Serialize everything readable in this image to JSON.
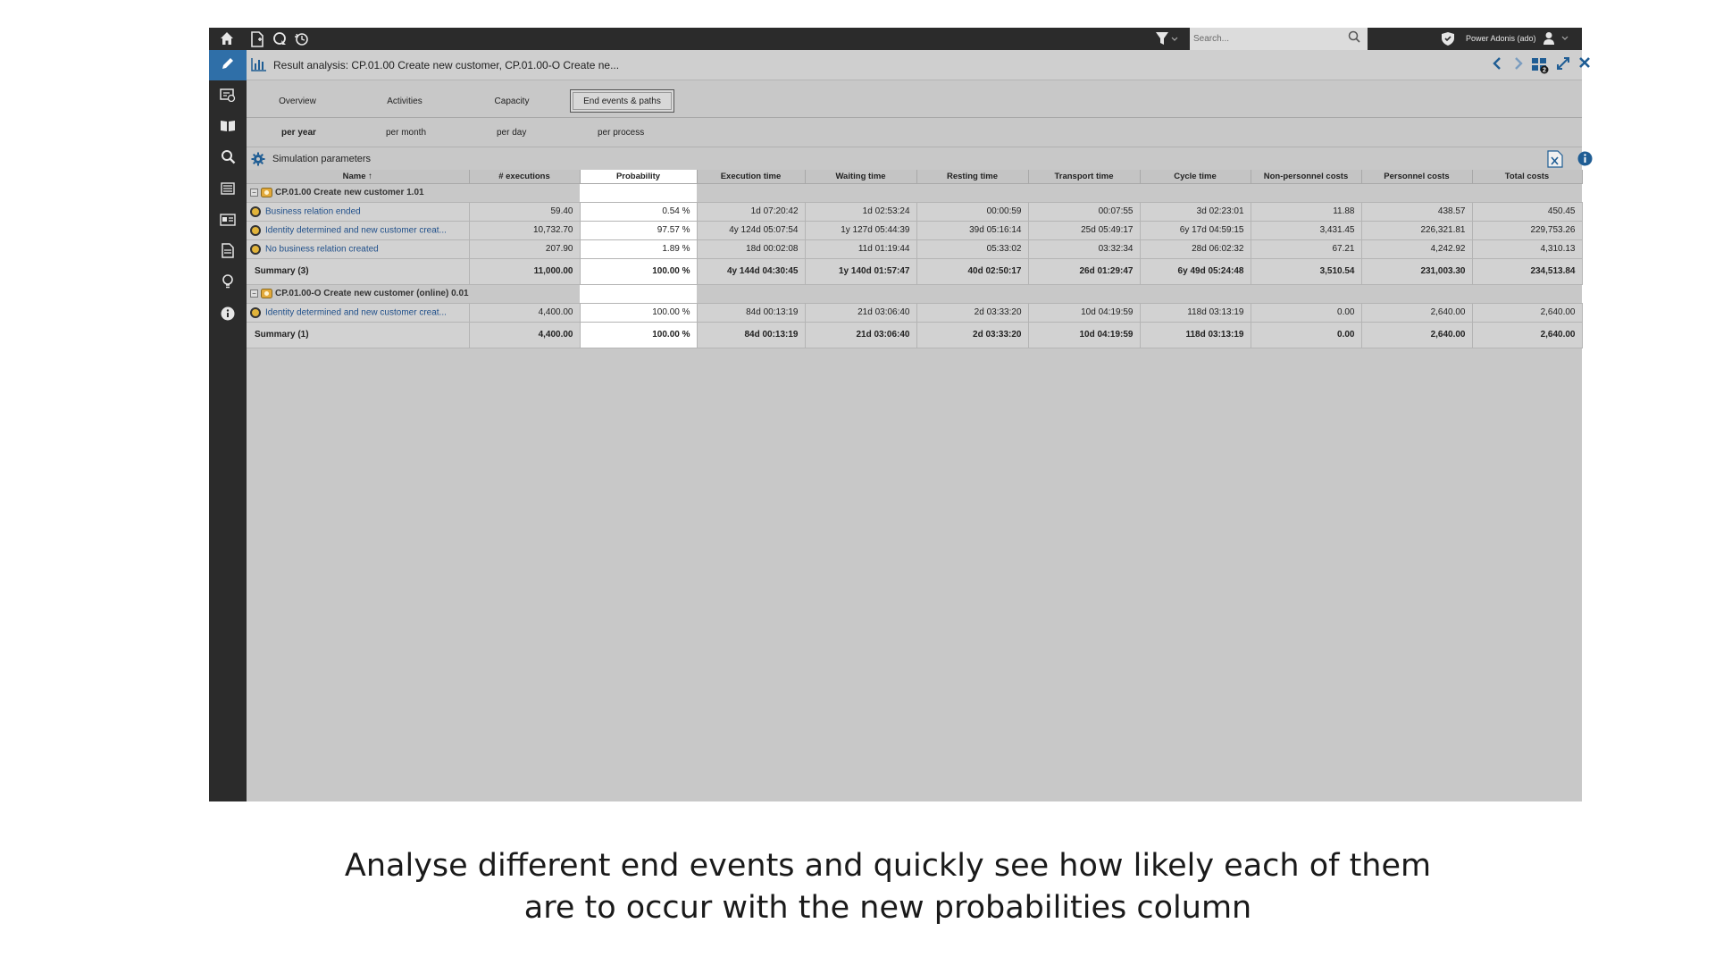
{
  "topbar": {
    "icons": [
      "home-icon",
      "new-document-icon",
      "refresh-icon",
      "history-icon",
      "filter-icon",
      "shield-icon",
      "user-icon"
    ],
    "search_placeholder": "Search...",
    "user": "Power Adonis (ado)"
  },
  "sidebar": {
    "items": [
      {
        "icon": "pencil-icon",
        "active": true
      },
      {
        "icon": "model-check-icon",
        "active": false
      },
      {
        "icon": "book-icon",
        "active": false
      },
      {
        "icon": "search-icon",
        "active": false
      },
      {
        "icon": "list-icon",
        "active": false
      },
      {
        "icon": "card-icon",
        "active": false
      },
      {
        "icon": "document-icon",
        "active": false
      },
      {
        "icon": "lightbulb-icon",
        "active": false
      },
      {
        "icon": "info-icon",
        "active": false
      }
    ]
  },
  "titlebar": {
    "title": "Result analysis: CP.01.00 Create new customer, CP.01.00-O Create ne..."
  },
  "tabs": [
    "Overview",
    "Activities",
    "Capacity",
    "End events & paths"
  ],
  "active_tab": "End events & paths",
  "subtabs": [
    "per year",
    "per month",
    "per day",
    "per process"
  ],
  "active_subtab": "per year",
  "sim_params_label": "Simulation parameters",
  "table": {
    "headers": [
      "Name ↑",
      "# executions",
      "Probability",
      "Execution time",
      "Waiting time",
      "Resting time",
      "Transport time",
      "Cycle time",
      "Non-personnel costs",
      "Personnel costs",
      "Total costs"
    ],
    "groups": [
      {
        "name": "CP.01.00 Create new customer 1.01",
        "rows": [
          [
            "Business relation ended",
            "59.40",
            "0.54 %",
            "1d 07:20:42",
            "1d 02:53:24",
            "00:00:59",
            "00:07:55",
            "3d 02:23:01",
            "11.88",
            "438.57",
            "450.45"
          ],
          [
            "Identity determined and new customer creat...",
            "10,732.70",
            "97.57 %",
            "4y 124d 05:07:54",
            "1y 127d 05:44:39",
            "39d 05:16:14",
            "25d 05:49:17",
            "6y 17d 04:59:15",
            "3,431.45",
            "226,321.81",
            "229,753.26"
          ],
          [
            "No business relation created",
            "207.90",
            "1.89 %",
            "18d 00:02:08",
            "11d 01:19:44",
            "05:33:02",
            "03:32:34",
            "28d 06:02:32",
            "67.21",
            "4,242.92",
            "4,310.13"
          ]
        ],
        "summary": [
          "Summary (3)",
          "11,000.00",
          "100.00 %",
          "4y 144d 04:30:45",
          "1y 140d 01:57:47",
          "40d 02:50:17",
          "26d 01:29:47",
          "6y 49d 05:24:48",
          "3,510.54",
          "231,003.30",
          "234,513.84"
        ]
      },
      {
        "name": "CP.01.00-O Create new customer (online) 0.01",
        "rows": [
          [
            "Identity determined and new customer creat...",
            "4,400.00",
            "100.00 %",
            "84d 00:13:19",
            "21d 03:06:40",
            "2d 03:33:20",
            "10d 04:19:59",
            "118d 03:13:19",
            "0.00",
            "2,640.00",
            "2,640.00"
          ]
        ],
        "summary": [
          "Summary (1)",
          "4,400.00",
          "100.00 %",
          "84d 00:13:19",
          "21d 03:06:40",
          "2d 03:33:20",
          "10d 04:19:59",
          "118d 03:13:19",
          "0.00",
          "2,640.00",
          "2,640.00"
        ]
      }
    ]
  },
  "caption": {
    "line1": "Analyse different end events and quickly see how likely each of them",
    "line2": "are to occur with the new probabilities column"
  },
  "colors": {
    "accent": "#2f6fa8",
    "event_fill": "#e2b43a",
    "link": "#1f4f8a"
  }
}
